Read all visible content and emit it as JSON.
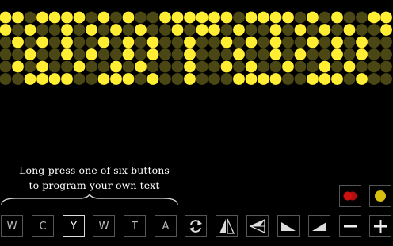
{
  "display": {
    "lit_color": "#ffee33",
    "dim_color": "#4a4715",
    "rows": [
      "XX.XXXX.X.X..XXXX",
      "X.X..X.X.X.X..X.X",
      ".X.X.X..X.X.X..X.",
      "..X..X.X..X.X..X.",
      ".X.X..X..X.X...X.",
      "..XXXX..XXX.X..X."
    ]
  },
  "hint": {
    "line1": "Long-press one of six buttons",
    "line2": "to program your own text"
  },
  "preset_buttons": [
    {
      "label": "W",
      "selected": false
    },
    {
      "label": "C",
      "selected": false
    },
    {
      "label": "Y",
      "selected": true
    },
    {
      "label": "W",
      "selected": false
    },
    {
      "label": "T",
      "selected": false
    },
    {
      "label": "A",
      "selected": false
    }
  ],
  "controls": [
    "repeat-icon",
    "flip-icon",
    "scroll-left-icon",
    "speed-slow-icon",
    "speed-fast-icon",
    "minus-icon",
    "plus-icon"
  ],
  "color_buttons": {
    "red_swatch": "#cc1111",
    "yellow_swatch": "#d8c010"
  }
}
